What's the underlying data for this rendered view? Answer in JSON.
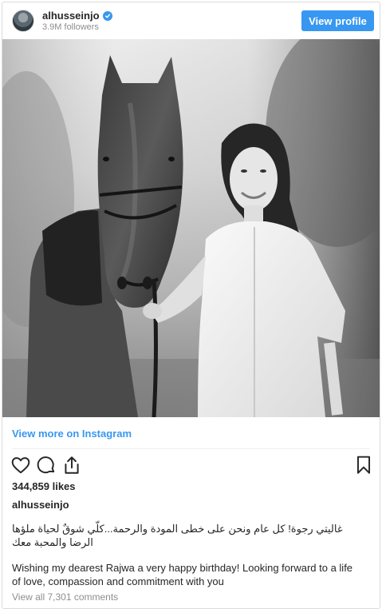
{
  "header": {
    "username": "alhusseinjo",
    "followers": "3.9M followers",
    "view_profile_label": "View profile",
    "verified_icon": "verified-badge-icon"
  },
  "post": {
    "image_alt": "",
    "view_more_label": "View more on Instagram",
    "likes": "344,859 likes",
    "caption_user": "alhusseinjo",
    "caption_arabic": "غاليتي رجوة! كل عام ونحن على خطى المودة والرحمة...كلّي شوقٌ لحياة ملؤها الرضا والمحبة معك",
    "caption_english": "Wishing my dearest Rajwa a very happy birthday! Looking forward to a life of love, compassion and commitment with you",
    "comments_link": "View all 7,301 comments"
  },
  "actions": {
    "like_icon": "heart-icon",
    "comment_icon": "comment-icon",
    "share_icon": "share-icon",
    "save_icon": "bookmark-icon"
  },
  "colors": {
    "accent": "#3897f0",
    "text": "#262626",
    "muted": "#8e8e8e",
    "border": "#dbdbdb"
  }
}
